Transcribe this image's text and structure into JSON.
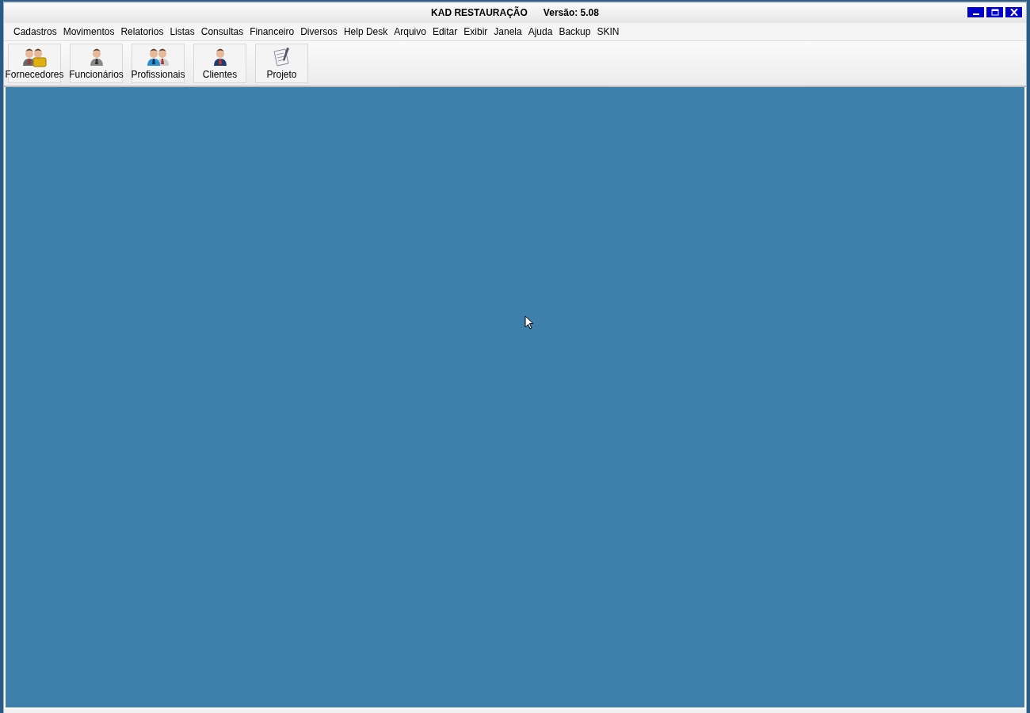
{
  "window": {
    "title": "KAD RESTAURAÇÃO",
    "version": "Versão: 5.08"
  },
  "menu": [
    {
      "label": "Cadastros"
    },
    {
      "label": "Movimentos"
    },
    {
      "label": "Relatorios"
    },
    {
      "label": "Listas"
    },
    {
      "label": "Consultas"
    },
    {
      "label": "Financeiro"
    },
    {
      "label": "Diversos"
    },
    {
      "label": "Help Desk"
    },
    {
      "label": "Arquivo"
    },
    {
      "label": "Editar"
    },
    {
      "label": "Exibir"
    },
    {
      "label": "Janela"
    },
    {
      "label": "Ajuda"
    },
    {
      "label": "Backup"
    },
    {
      "label": "SKIN"
    }
  ],
  "toolbar": [
    {
      "label": "Fornecedores",
      "kind": "suppliers"
    },
    {
      "label": "Funcionários",
      "kind": "employee"
    },
    {
      "label": "Profissionais",
      "kind": "professionals"
    },
    {
      "label": "Clientes",
      "kind": "client"
    },
    {
      "label": "Projeto",
      "kind": "project"
    }
  ]
}
